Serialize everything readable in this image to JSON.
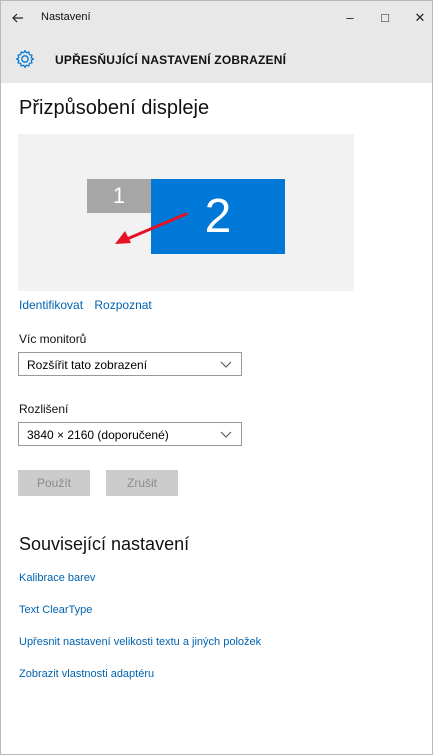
{
  "window": {
    "title": "Nastavení",
    "back_icon": "arrow-left-icon",
    "minimize_glyph": "–",
    "maximize_glyph": "□",
    "close_glyph": "✕"
  },
  "header": {
    "icon": "gear-icon",
    "title": "UPŘESŇUJÍCÍ NASTAVENÍ ZOBRAZENÍ"
  },
  "main": {
    "heading": "Přizpůsobení displeje",
    "preview": {
      "monitors": [
        {
          "label": "1",
          "color": "#a6a6a6"
        },
        {
          "label": "2",
          "color": "#0078d7"
        }
      ],
      "arrow_color": "#e81123"
    },
    "identify_link": "Identifikovat",
    "detect_link": "Rozpoznat",
    "multi_monitor": {
      "label": "Víc monitorů",
      "value": "Rozšířit tato zobrazení"
    },
    "resolution": {
      "label": "Rozlišení",
      "value": "3840 × 2160 (doporučené)"
    },
    "apply_button": "Použít",
    "cancel_button": "Zrušit"
  },
  "related": {
    "heading": "Související nastavení",
    "links": [
      "Kalibrace barev",
      "Text ClearType",
      "Upřesnit nastavení velikosti textu a jiných položek",
      "Zobrazit vlastnosti adaptéru"
    ]
  },
  "colors": {
    "accent": "#0078d7",
    "link": "#0063b1",
    "chrome": "#e8e8e8"
  }
}
